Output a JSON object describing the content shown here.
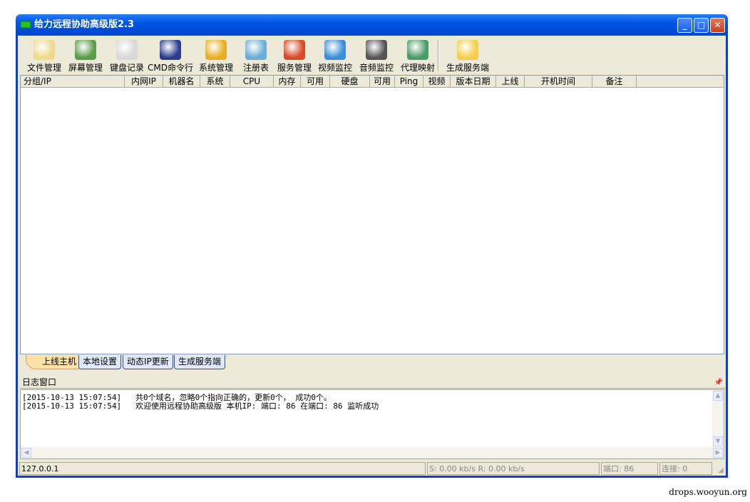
{
  "window": {
    "title": "给力远程协助高级版2.3"
  },
  "toolbar": [
    {
      "label": "文件管理",
      "icon": "folder-icon",
      "color": "#f0d98a"
    },
    {
      "label": "屏幕管理",
      "icon": "monitor-icon",
      "color": "#5a9c4a"
    },
    {
      "label": "键盘记录",
      "icon": "notepad-icon",
      "color": "#d8d8d8"
    },
    {
      "label": "CMD命令行",
      "icon": "terminal-icon",
      "color": "#2b3d8f"
    },
    {
      "label": "系统管理",
      "icon": "gears-icon",
      "color": "#e8b020"
    },
    {
      "label": "注册表",
      "icon": "registry-icon",
      "color": "#6aaed6"
    },
    {
      "label": "服务管理",
      "icon": "windows-icon",
      "color": "#d84a2a"
    },
    {
      "label": "视频监控",
      "icon": "webcam-icon",
      "color": "#3a8fd8"
    },
    {
      "label": "音频监控",
      "icon": "headphones-icon",
      "color": "#555555"
    },
    {
      "label": "代理映射",
      "icon": "globe-icon",
      "color": "#4a9a6a"
    },
    {
      "label": "生成服务端",
      "icon": "box-icon",
      "color": "#f5cf4a"
    }
  ],
  "columns": [
    "分组/IP",
    "内网IP",
    "机器名",
    "系统",
    "CPU",
    "内存",
    "可用",
    "硬盘",
    "可用",
    "Ping",
    "视频",
    "版本日期",
    "上线",
    "开机时间",
    "备注"
  ],
  "tabs": [
    "上线主机",
    "本地设置",
    "动态IP更新",
    "生成服务端"
  ],
  "log": {
    "title": "日志窗口",
    "lines": [
      "[2015-10-13 15:07:54]   共0个域名，忽略0个指向正确的，更新0个， 成功0个。",
      "[2015-10-13 15:07:54]   欢迎使用远程协助高级版 本机IP: 端口: 86 在端口: 86 监听成功"
    ]
  },
  "status": {
    "ip": "127.0.0.1",
    "speed": "S: 0.00 kb/s R: 0.00 kb/s",
    "port": "端口: 86",
    "conn": "连接: 0"
  },
  "watermark": "drops.wooyun.org"
}
